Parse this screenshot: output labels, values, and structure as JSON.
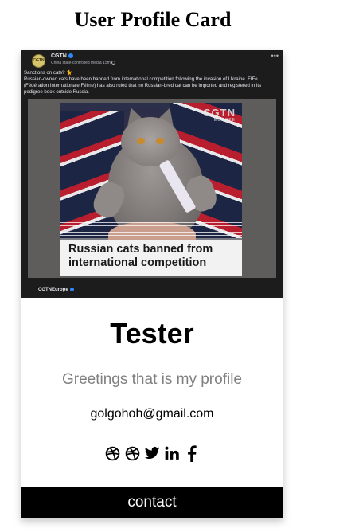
{
  "page": {
    "title": "User Profile Card"
  },
  "post": {
    "account_name": "CGTN",
    "avatar_text": "CGTN",
    "meta_label": "China state-controlled media",
    "meta_time": "15m",
    "caption_line1": "Sanctions on cats? 🐈",
    "caption_line2": "Russian-owned cats have been banned from international competition following the invasion of Ukraine. FIFe (Fédération Internationale Féline) has also ruled that no Russian-bred cat can be imported and registered in its pedigree book outside Russia.",
    "watermark_main": "CGTN",
    "watermark_sub": "EUROPE",
    "headline": "Russian cats banned from international competition",
    "footer_account": "CGTNEurope"
  },
  "profile": {
    "name": "Tester",
    "greeting": "Greetings that is my profile",
    "email": "golgohoh@gmail.com"
  },
  "social": [
    {
      "icon": "dribbble-icon"
    },
    {
      "icon": "dribbble-icon"
    },
    {
      "icon": "twitter-icon"
    },
    {
      "icon": "linkedin-icon"
    },
    {
      "icon": "facebook-icon"
    }
  ],
  "contact": {
    "label": "contact"
  },
  "colors": {
    "button_bg": "#000000",
    "button_text": "#ffffff",
    "greeting_text": "#808080",
    "post_bg": "#1c1c1d"
  }
}
